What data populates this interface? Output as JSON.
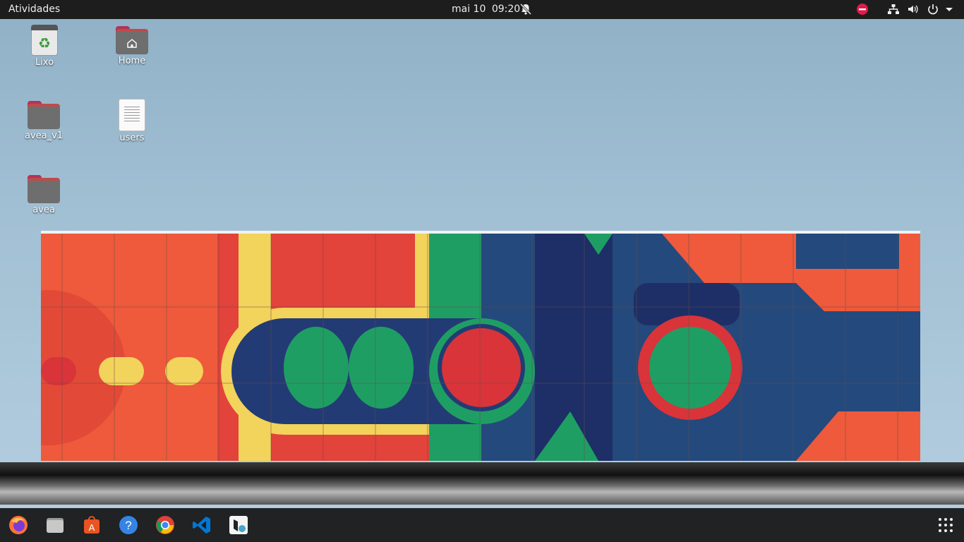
{
  "topbar": {
    "activities": "Atividades",
    "date": "mai 10",
    "time": "09:20",
    "icons": [
      "notifications-off-icon",
      "do-not-disturb-icon",
      "network-icon",
      "volume-icon",
      "power-icon",
      "chevron-down-icon"
    ]
  },
  "desktop": {
    "icons": [
      {
        "label": "Lixo",
        "icon": "trash-icon"
      },
      {
        "label": "Home",
        "icon": "home-folder-icon"
      },
      {
        "label": "avea_v1",
        "icon": "folder-icon"
      },
      {
        "label": "users",
        "icon": "text-file-icon"
      },
      {
        "label": "avea",
        "icon": "folder-icon"
      }
    ]
  },
  "dock": {
    "items": [
      "firefox-icon",
      "files-icon",
      "software-center-icon",
      "help-icon",
      "chrome-icon",
      "vscode-icon",
      "app-icon"
    ],
    "show_apps": "show-applications-icon"
  },
  "colors": {
    "topbar": "#1d1d1d",
    "dock": "#141414",
    "folder_gray": "#6e6e6e",
    "mural_orange": "#ef5b3b",
    "mural_blue": "#22406e",
    "mural_green": "#1f9e64",
    "mural_yellow": "#f2d35b"
  }
}
